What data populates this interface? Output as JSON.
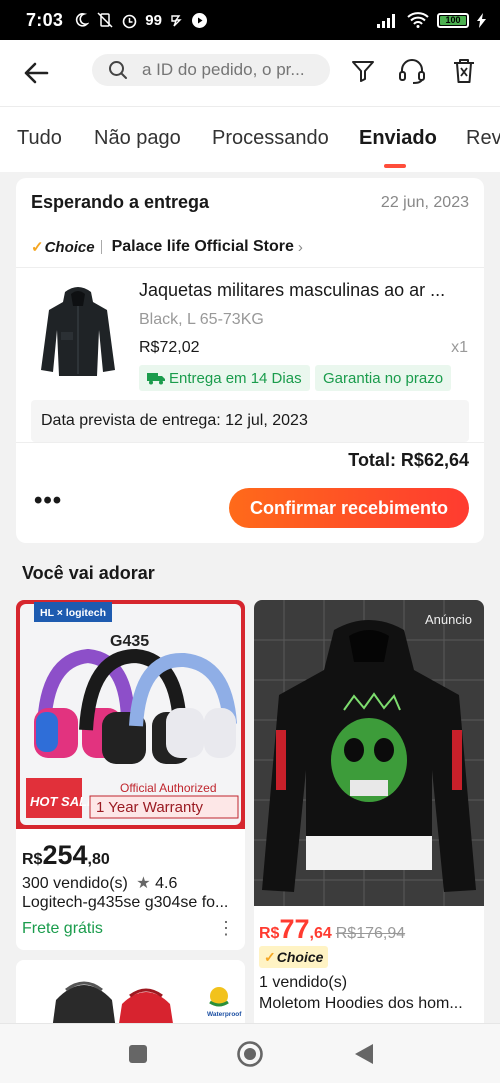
{
  "status_bar": {
    "time": "7:03",
    "notification_icons": [
      "moon-icon",
      "vibrate-off-icon",
      "alarm-icon",
      "99",
      "sync-icon",
      "play-icon"
    ],
    "battery": "100"
  },
  "header": {
    "search_placeholder": "a ID do pedido, o pr..."
  },
  "tabs": [
    {
      "label": "Tudo"
    },
    {
      "label": "Não pago"
    },
    {
      "label": "Processando"
    },
    {
      "label": "Enviado",
      "active": true
    },
    {
      "label": "Revi"
    }
  ],
  "order": {
    "status": "Esperando a entrega",
    "date": "22 jun, 2023",
    "choice_label": "Choice",
    "store_name": "Palace life Official Store",
    "product_title": "Jaquetas militares masculinas ao ar ...",
    "variant": "Black, L 65-73KG",
    "price": "R$72,02",
    "quantity": "x1",
    "tags": [
      "Entrega em 14 Dias",
      "Garantia no prazo"
    ],
    "eta": "Data prevista de entrega: 12 jul, 2023",
    "total": "Total: R$62,64",
    "more": "•••",
    "confirm_label": "Confirmar recebimento"
  },
  "recommendations": {
    "title": "Você vai adorar",
    "items": [
      {
        "image_texts": {
          "brand": "HL × logitech",
          "model": "G435",
          "hot_sale": "HOT SALE",
          "official": "Official Authorized",
          "warranty": "1 Year Warranty"
        },
        "currency": "R$",
        "price_int": "254",
        "price_dec": ",80",
        "sold": "300  vendido(s)",
        "rating": "4.6",
        "title": "Logitech-g435se g304se fo...",
        "shipping": "Frete grátis"
      },
      {
        "ad_label": "Anúncio",
        "currency": "R$",
        "price_int": "77",
        "price_dec": ",64",
        "old_price": "R$176,94",
        "choice_label": "Choice",
        "sold": "1  vendido(s)",
        "title": "Moletom Hoodies dos hom..."
      },
      {
        "waterproof_label": "Waterproof"
      }
    ]
  },
  "colors": {
    "accent": "#ff3b30",
    "button_gradient_start": "#ff6a1a",
    "green": "#1a9c4c",
    "choice_gold": "#f5a623"
  }
}
